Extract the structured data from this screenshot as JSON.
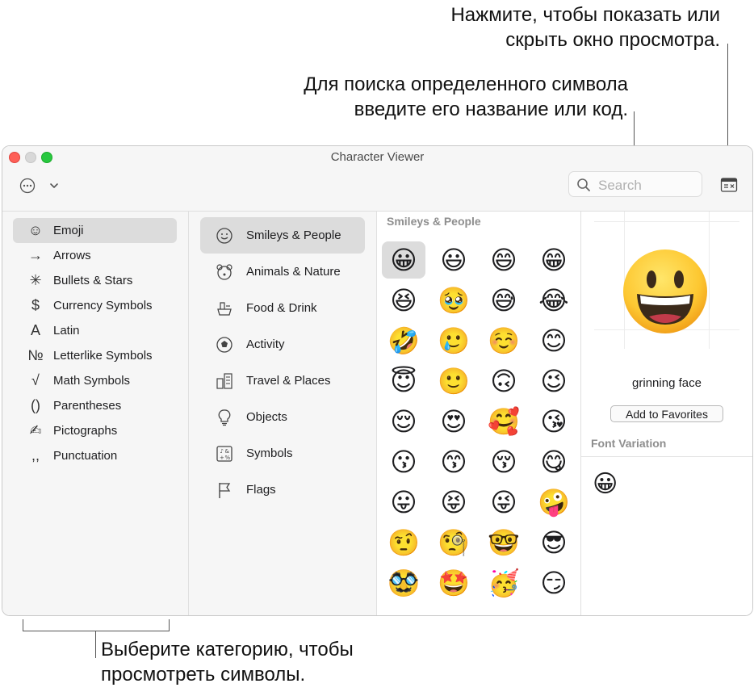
{
  "callouts": {
    "preview": [
      "Нажмите, чтобы показать или",
      "скрыть окно просмотра."
    ],
    "search": [
      "Для поиска определенного символа",
      "введите его название или код."
    ],
    "category": [
      "Выберите категорию, чтобы",
      "просмотреть символы."
    ]
  },
  "window": {
    "title": "Character Viewer"
  },
  "search": {
    "placeholder": "Search",
    "icon": "magnifier-icon"
  },
  "toolbar": {
    "action_icon": "ellipsis-circle-icon",
    "menu_icon": "chevron-down-icon",
    "preview_toggle_icon": "sidebar-preview-icon"
  },
  "left_categories": [
    {
      "label": "Emoji",
      "icon": "☺"
    },
    {
      "label": "Arrows",
      "icon": "→"
    },
    {
      "label": "Bullets & Stars",
      "icon": "✳"
    },
    {
      "label": "Currency Symbols",
      "icon": "$"
    },
    {
      "label": "Latin",
      "icon": "A"
    },
    {
      "label": "Letterlike Symbols",
      "icon": "№"
    },
    {
      "label": "Math Symbols",
      "icon": "√"
    },
    {
      "label": "Parentheses",
      "icon": "()"
    },
    {
      "label": "Pictographs",
      "icon": "✍"
    },
    {
      "label": "Punctuation",
      "icon": ",,"
    }
  ],
  "selected_left": 0,
  "subcategories": [
    {
      "label": "Smileys & People",
      "icon": "smiley-outline-icon"
    },
    {
      "label": "Animals & Nature",
      "icon": "bear-outline-icon"
    },
    {
      "label": "Food & Drink",
      "icon": "food-outline-icon"
    },
    {
      "label": "Activity",
      "icon": "soccer-ball-icon"
    },
    {
      "label": "Travel & Places",
      "icon": "buildings-icon"
    },
    {
      "label": "Objects",
      "icon": "lightbulb-icon"
    },
    {
      "label": "Symbols",
      "icon": "symbols-icon"
    },
    {
      "label": "Flags",
      "icon": "flag-icon"
    }
  ],
  "selected_sub": 0,
  "grid": {
    "heading": "Smileys & People",
    "emojis": [
      "😀",
      "😃",
      "😄",
      "😁",
      "😆",
      "🥹",
      "😅",
      "😂",
      "🤣",
      "🥲",
      "☺️",
      "😊",
      "😇",
      "🙂",
      "🙃",
      "😉",
      "😌",
      "😍",
      "🥰",
      "😘",
      "😗",
      "😙",
      "😚",
      "😋",
      "😛",
      "😝",
      "😜",
      "🤪",
      "🤨",
      "🧐",
      "🤓",
      "😎",
      "🥸",
      "🤩",
      "🥳",
      "😏"
    ],
    "selected": 0
  },
  "preview": {
    "glyph": "😀",
    "name": "grinning face",
    "add_favorites_label": "Add to Favorites",
    "font_variation_heading": "Font Variation",
    "variations": [
      "😀"
    ]
  }
}
